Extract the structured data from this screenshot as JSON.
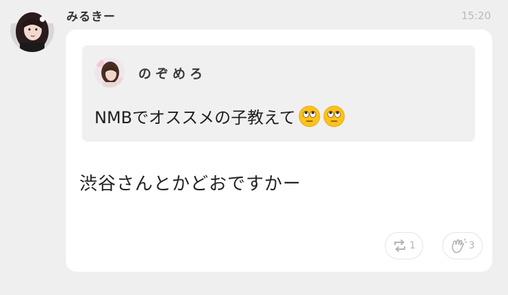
{
  "message": {
    "sender_name": "みるきー",
    "time": "15:20",
    "quoted": {
      "author_name": "のぞめろ",
      "text": "NMBでオススメの子教えて",
      "emojis": [
        "face-with-rolling-eyes-emoji",
        "face-with-rolling-eyes-emoji"
      ]
    },
    "body": "渋谷さんとかどおですかー",
    "actions": {
      "retweet_count": "1",
      "clap_count": "3"
    }
  },
  "colors": {
    "background": "#efefef",
    "card": "#ffffff",
    "quote_background": "#f0f0f0",
    "muted_text": "#b3b3b3"
  }
}
